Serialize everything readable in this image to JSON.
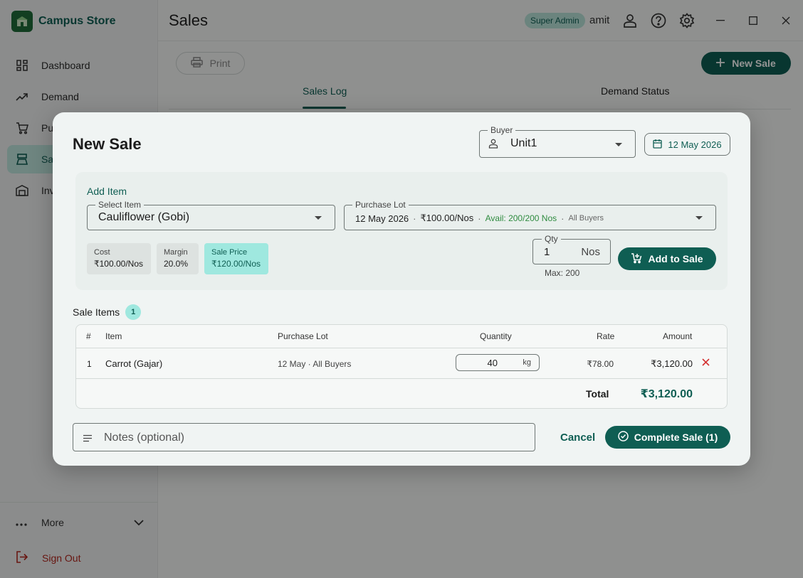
{
  "app": {
    "name": "Campus Store",
    "page_title": "Sales",
    "role_badge": "Super Admin",
    "user": "amit"
  },
  "sidebar": {
    "items": [
      {
        "label": "Dashboard",
        "icon": "dashboard-icon",
        "active": false
      },
      {
        "label": "Demand",
        "icon": "trending-up-icon",
        "active": false
      },
      {
        "label": "Pu",
        "icon": "cart-icon",
        "active": false
      },
      {
        "label": "Sal",
        "icon": "scale-icon",
        "active": true
      },
      {
        "label": "Inv",
        "icon": "warehouse-icon",
        "active": false
      }
    ],
    "more_label": "More",
    "signout_label": "Sign Out"
  },
  "toolbar": {
    "print_label": "Print",
    "new_sale_label": "New Sale"
  },
  "tabs": [
    {
      "label": "Sales Log",
      "active": true
    },
    {
      "label": "Demand Status",
      "active": false
    }
  ],
  "modal": {
    "title": "New Sale",
    "buyer": {
      "label": "Buyer",
      "value": "Unit1"
    },
    "date": "12 May 2026",
    "add_item": {
      "title": "Add Item",
      "select_item": {
        "label": "Select Item",
        "value": "Cauliflower (Gobi)"
      },
      "purchase_lot": {
        "label": "Purchase Lot",
        "date": "12 May 2026",
        "price": "₹100.00/Nos",
        "avail": "Avail: 200/200 Nos",
        "buyers": "All Buyers"
      },
      "cost": {
        "label": "Cost",
        "value": "₹100.00/Nos"
      },
      "margin": {
        "label": "Margin",
        "value": "20.0%"
      },
      "sale_price": {
        "label": "Sale Price",
        "value": "₹120.00/Nos"
      },
      "qty": {
        "label": "Qty",
        "value": "1",
        "unit": "Nos",
        "max": "Max: 200"
      },
      "add_button": "Add to Sale"
    },
    "sale_items": {
      "title": "Sale Items",
      "count": "1",
      "columns": [
        "#",
        "Item",
        "Purchase Lot",
        "Quantity",
        "Rate",
        "Amount"
      ],
      "rows": [
        {
          "index": "1",
          "item": "Carrot (Gajar)",
          "lot": "12 May · All Buyers",
          "qty": "40",
          "unit": "kg",
          "rate": "₹78.00",
          "amount": "₹3,120.00"
        }
      ],
      "total_label": "Total",
      "total_value": "₹3,120.00"
    },
    "notes_placeholder": "Notes (optional)",
    "cancel_label": "Cancel",
    "complete_label": "Complete Sale (1)"
  },
  "colors": {
    "primary": "#0f5e53",
    "accent_light": "#9fe8df",
    "available": "#2e8b3f",
    "danger": "#b3261e"
  }
}
